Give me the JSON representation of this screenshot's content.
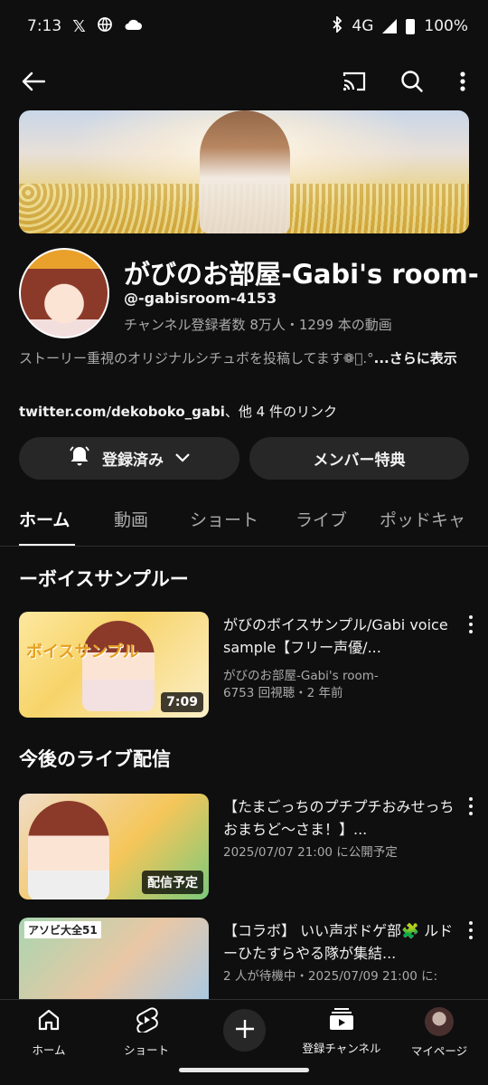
{
  "status_bar": {
    "time": "7:13",
    "network": "4G",
    "battery": "100%"
  },
  "channel": {
    "name": "がびのお部屋-Gabi's room-",
    "handle": "@-gabisroom-4153",
    "stats": "チャンネル登録者数 8万人・1299 本の動画",
    "description": "ストーリー重視のオリジナルシチュボを投稿してます❁⃘.°",
    "more_label": "...さらに表示",
    "link_main": "twitter.com/dekoboko_gabi",
    "link_suffix": "、他 4 件のリンク"
  },
  "buttons": {
    "subscribed": "登録済み",
    "membership": "メンバー特典"
  },
  "tabs": [
    "ホーム",
    "動画",
    "ショート",
    "ライブ",
    "ポッドキャ"
  ],
  "sections": {
    "voice_sample": "ーボイスサンプルー",
    "upcoming_live": "今後のライブ配信"
  },
  "videos": [
    {
      "title": "がびのボイスサンプル/Gabi voice sample【フリー声優/...",
      "channel": "がびのお部屋-Gabi's room-",
      "meta": "6753 回視聴・2 年前",
      "badge": "7:09",
      "thumb_text": "ボイスサンプル"
    },
    {
      "title": "【たまごっちのプチプチおみせっち おまちど〜さま！】...",
      "meta": "2025/07/07 21:00 に公開予定",
      "badge": "配信予定"
    },
    {
      "title": "【コラボ】 いい声ボドゲ部🧩 ルドーひたすらやる隊が集結...",
      "meta": "2 人が待機中・2025/07/09 21:00 に:",
      "thumb_text": "アソビ大全51"
    }
  ],
  "bottom_nav": [
    {
      "label": "ホーム",
      "icon": "home-icon"
    },
    {
      "label": "ショート",
      "icon": "shorts-icon"
    },
    {
      "label": "",
      "icon": "create-plus-icon"
    },
    {
      "label": "登録チャンネル",
      "icon": "subscriptions-icon"
    },
    {
      "label": "マイページ",
      "icon": "profile-avatar"
    }
  ]
}
